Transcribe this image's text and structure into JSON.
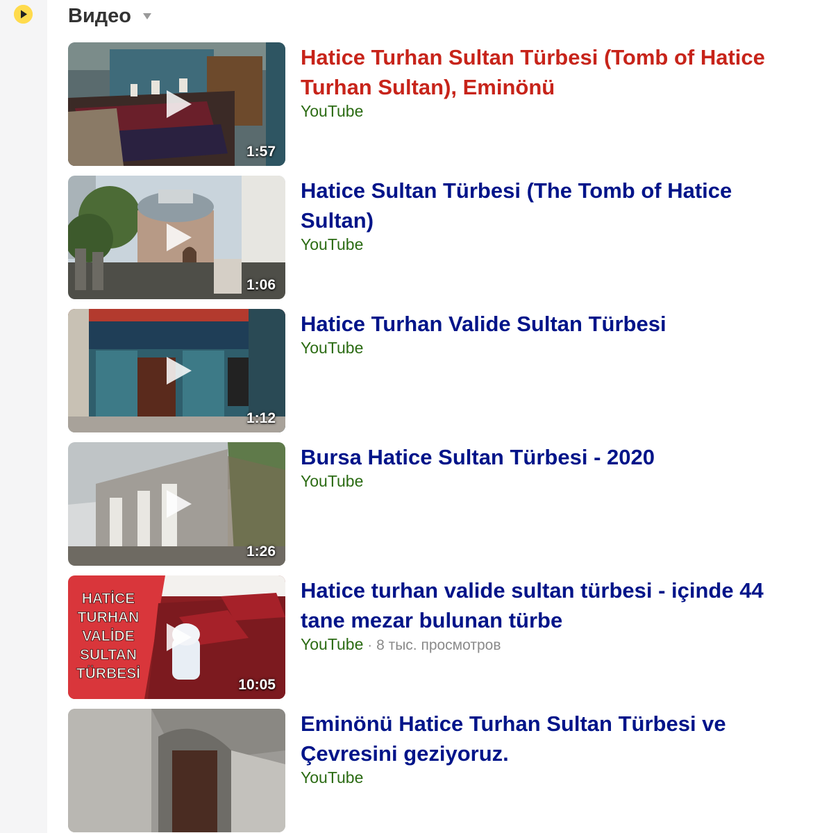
{
  "section": {
    "icon": "play-circle-icon",
    "title": "Видео",
    "caret_icon": "triangle-down-icon"
  },
  "colors": {
    "link": "#001489",
    "visited_link": "#c7241a",
    "source": "#2b6b13",
    "meta": "#8a8a8a",
    "accent": "#ffdb4d"
  },
  "videos": [
    {
      "title_parts": [
        {
          "text": "Hatice",
          "bold": true
        },
        {
          "text": " Turhan ",
          "bold": false
        },
        {
          "text": "Sultan Türbesi",
          "bold": true
        },
        {
          "text": " (Tomb of ",
          "bold": false
        },
        {
          "text": "Hatice",
          "bold": true
        },
        {
          "text": " Turhan Sultan), Eminönü",
          "bold": false
        }
      ],
      "visited": true,
      "source": "YouTube",
      "views": "",
      "duration": "1:57"
    },
    {
      "title_parts": [
        {
          "text": "Hatice Sultan Türbesi",
          "bold": true
        },
        {
          "text": " (The Tomb of ",
          "bold": false
        },
        {
          "text": "Hatice Sultan",
          "bold": true
        },
        {
          "text": ")",
          "bold": false
        }
      ],
      "visited": false,
      "source": "YouTube",
      "views": "",
      "duration": "1:06"
    },
    {
      "title_parts": [
        {
          "text": "Hatice",
          "bold": true
        },
        {
          "text": " Turhan Valide ",
          "bold": false
        },
        {
          "text": "Sultan Türbesi",
          "bold": true
        }
      ],
      "visited": false,
      "source": "YouTube",
      "views": "",
      "duration": "1:12"
    },
    {
      "title_parts": [
        {
          "text": "Bursa ",
          "bold": false
        },
        {
          "text": "Hatice Sultan Türbesi",
          "bold": true
        },
        {
          "text": " - 2020",
          "bold": false
        }
      ],
      "visited": false,
      "source": "YouTube",
      "views": "",
      "duration": "1:26"
    },
    {
      "title_parts": [
        {
          "text": "Hatice",
          "bold": true
        },
        {
          "text": " turhan valide ",
          "bold": false
        },
        {
          "text": "sultan türbesi",
          "bold": true
        },
        {
          "text": " - içinde 44 tane mezar bulunan türbe",
          "bold": false
        }
      ],
      "visited": false,
      "source": "YouTube",
      "views": "8 тыс. просмотров",
      "duration": "10:05",
      "thumb_caption": [
        "HATİCE",
        "TURHAN",
        "VALİDE",
        "SULTAN",
        "TÜRBESİ"
      ]
    },
    {
      "title_parts": [
        {
          "text": "Eminönü ",
          "bold": false
        },
        {
          "text": "Hatice",
          "bold": true
        },
        {
          "text": " Turhan ",
          "bold": false
        },
        {
          "text": "Sultan Türbesi",
          "bold": true
        },
        {
          "text": " ve Çevresini geziyoruz.",
          "bold": false
        }
      ],
      "visited": false,
      "source": "YouTube",
      "views": "",
      "duration": ""
    }
  ]
}
